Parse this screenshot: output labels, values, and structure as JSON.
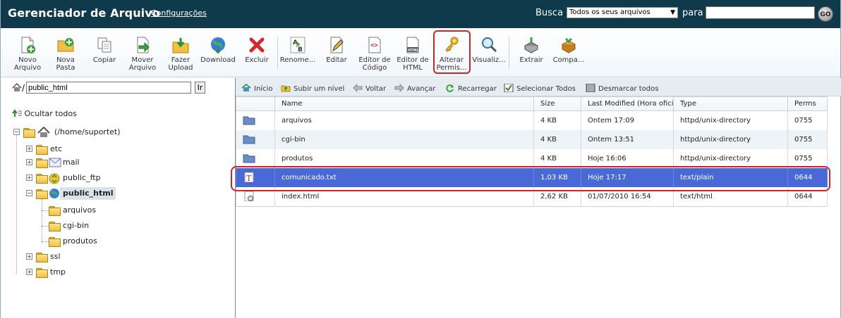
{
  "app": {
    "title": "Gerenciador de Arquivo",
    "settings_link": "Configurações"
  },
  "search": {
    "label": "Busca",
    "scope_value": "Todos os seus arquivos",
    "para_label": "para",
    "input_value": "",
    "go_label": "GO"
  },
  "toolbar": {
    "new_file": [
      "Novo",
      "Arquivo"
    ],
    "new_folder": [
      "Nova",
      "Pasta"
    ],
    "copy": [
      "Copiar"
    ],
    "move": [
      "Mover",
      "Arquivo"
    ],
    "upload": [
      "Fazer",
      "Upload"
    ],
    "download": [
      "Download"
    ],
    "delete": [
      "Excluir"
    ],
    "rename": [
      "Renome..."
    ],
    "edit": [
      "Editar"
    ],
    "code_editor": [
      "Editor de",
      "Código"
    ],
    "html_editor": [
      "Editor de",
      "HTML"
    ],
    "permissions": [
      "Alterar",
      "Permis..."
    ],
    "view": [
      "Visualiz..."
    ],
    "extract": [
      "Extrair"
    ],
    "compress": [
      "Compa..."
    ]
  },
  "path": {
    "slash": "/",
    "value": "public_html",
    "go_label": "Ir"
  },
  "tree": {
    "collapse_all": "Ocultar todos",
    "root": "(/home/suportet)",
    "items": [
      "etc",
      "mail",
      "public_ftp",
      "public_html",
      "arquivos",
      "cgi-bin",
      "produtos",
      "ssl",
      "tmp"
    ]
  },
  "nav": {
    "home": "Início",
    "up": "Subir um nível",
    "back": "Voltar",
    "forward": "Avançar",
    "reload": "Recarregar",
    "select_all": "Selecionar Todos",
    "deselect_all": "Desmarcar todos"
  },
  "table": {
    "headers": [
      "Name",
      "Size",
      "Last Modified (Hora oficial)",
      "Type",
      "Perms"
    ],
    "rows": [
      {
        "name": "arquivos",
        "size": "4 KB",
        "modified": "Ontem 17:09",
        "type": "httpd/unix-directory",
        "perms": "0755"
      },
      {
        "name": "cgi-bin",
        "size": "4 KB",
        "modified": "Ontem 13:51",
        "type": "httpd/unix-directory",
        "perms": "0755"
      },
      {
        "name": "produtos",
        "size": "4 KB",
        "modified": "Hoje 16:06",
        "type": "httpd/unix-directory",
        "perms": "0755"
      },
      {
        "name": "comunicado.txt",
        "size": "1,03 KB",
        "modified": "Hoje 17:17",
        "type": "text/plain",
        "perms": "0644"
      },
      {
        "name": "index.html",
        "size": "2,62 KB",
        "modified": "01/07/2010 16:54",
        "type": "text/html",
        "perms": "0644"
      }
    ]
  },
  "colors": {
    "topbar": "#0f3a4b",
    "selected_row": "#4a68d6",
    "highlight": "#c8262e"
  }
}
